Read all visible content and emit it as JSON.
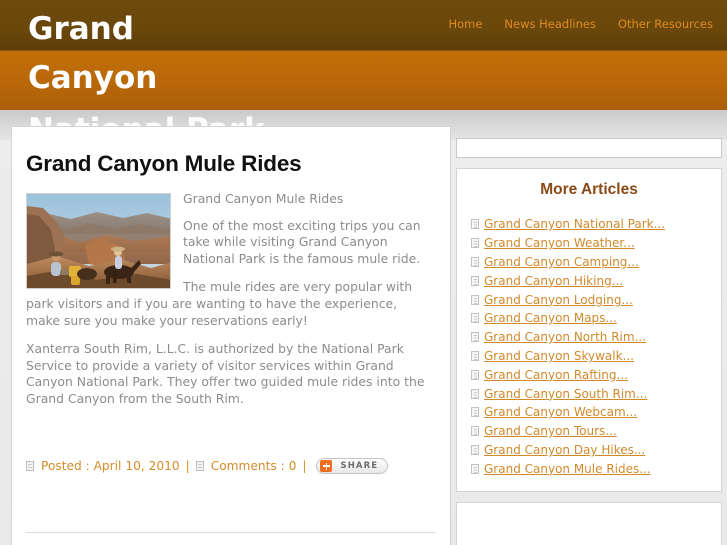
{
  "site": {
    "title_words": [
      "Grand",
      "Canyon",
      "National Park"
    ],
    "nav": [
      {
        "label": "Home"
      },
      {
        "label": "News Headlines"
      },
      {
        "label": "Other Resources"
      }
    ]
  },
  "article": {
    "title": "Grand Canyon Mule Rides",
    "caption": "Grand Canyon Mule Rides",
    "thumbnail_alt": "Mule riders on a Grand Canyon trail",
    "paragraph_1": "One of the most exciting trips you can take while visiting Grand Canyon National Park is the famous mule ride.",
    "paragraph_2": "The mule rides are very popular with park visitors and if you are wanting to have the experience, make sure you make your reservations early!",
    "paragraph_3": "Xanterra South Rim, L.L.C. is authorized by the National Park Service to provide a variety of visitor services within Grand Canyon National Park. They offer two guided mule rides into the Grand Canyon from the South Rim.",
    "meta": {
      "posted_label": "Posted : April 10, 2010",
      "separator": "|",
      "comments_label": "Comments : 0",
      "share_label": "SHARE"
    }
  },
  "sidebar": {
    "search_placeholder": "",
    "search_value": "",
    "more_articles_title": "More Articles",
    "links": [
      {
        "label": "Grand Canyon National Park..."
      },
      {
        "label": "Grand Canyon Weather..."
      },
      {
        "label": "Grand Canyon Camping..."
      },
      {
        "label": "Grand Canyon Hiking..."
      },
      {
        "label": "Grand Canyon Lodging..."
      },
      {
        "label": "Grand Canyon Maps..."
      },
      {
        "label": "Grand Canyon North Rim..."
      },
      {
        "label": "Grand Canyon Skywalk..."
      },
      {
        "label": "Grand Canyon Rafting..."
      },
      {
        "label": "Grand Canyon South Rim..."
      },
      {
        "label": "Grand Canyon Webcam..."
      },
      {
        "label": "Grand Canyon Tours..."
      },
      {
        "label": "Grand Canyon Day Hikes..."
      },
      {
        "label": "Grand Canyon Mule Rides..."
      }
    ]
  },
  "colors": {
    "header_dark": "#6a470b",
    "header_orange": "#b9680a",
    "link_orange": "#d08a2c",
    "heading_brown": "#8a4a16",
    "nav_link": "#e08a1e",
    "body_text": "#8c8c8c",
    "page_bg": "#e6e6e6"
  }
}
